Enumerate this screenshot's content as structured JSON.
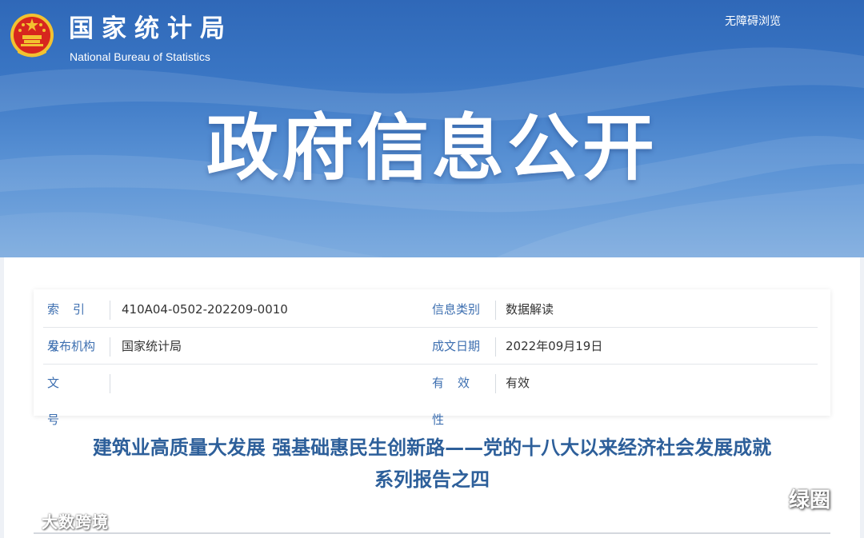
{
  "header": {
    "org_name_cn": "国家统计局",
    "org_name_en": "National Bureau of Statistics",
    "accessibility_link": "无障碍浏览",
    "banner_title": "政府信息公开"
  },
  "info_table": {
    "rows": [
      {
        "label_left": "索引号",
        "value_left": "410A04-0502-202209-0010",
        "label_right": "信息类别",
        "value_right": "数据解读"
      },
      {
        "label_left": "发布机构",
        "value_left": "国家统计局",
        "label_right": "成文日期",
        "value_right": "2022年09月19日"
      },
      {
        "label_left": "文号",
        "value_left": "",
        "label_right": "有效性",
        "value_right": "有效"
      }
    ]
  },
  "article": {
    "title_line1": "建筑业高质量大发展 强基础惠民生创新路——党的十八大以来经济社会发展成就",
    "title_line2": "系列报告之四"
  },
  "watermarks": {
    "left": "大数跨境",
    "right": "绿圈"
  },
  "colors": {
    "banner_blue": "#3a76c4",
    "label_blue": "#3d6fb0",
    "title_blue": "#2d5f9a",
    "emblem_red": "#d7261e",
    "emblem_gold": "#f2c230"
  },
  "icons": [
    "national-emblem-icon",
    "wechat-icon",
    "brand-logo-icon"
  ]
}
